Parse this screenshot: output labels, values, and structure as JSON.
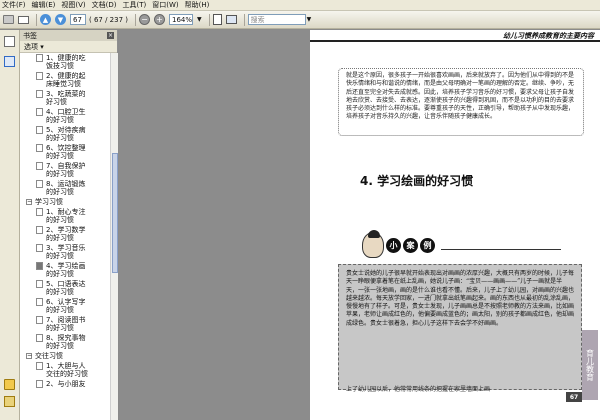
{
  "menu": [
    "文件(F)",
    "编辑(E)",
    "视图(V)",
    "文档(D)",
    "工具(T)",
    "窗口(W)",
    "帮助(H)"
  ],
  "toolbar": {
    "page_input": "67",
    "page_count": "( 67 / 237 )",
    "zoom": "164%",
    "search_placeholder": "搜索"
  },
  "panel": {
    "title": "书签",
    "close": "×",
    "options": "选项 ▾"
  },
  "bookmarks": [
    {
      "kind": "item",
      "label": "1、健康的吃\n饭技习惯"
    },
    {
      "kind": "item",
      "label": "2、健康的起\n床睡觉习惯"
    },
    {
      "kind": "item",
      "label": "3、吃蔬菜的\n好习惯"
    },
    {
      "kind": "item",
      "label": "4、口腔卫生\n的好习惯"
    },
    {
      "kind": "item",
      "label": "5、对待疾病\n的好习惯"
    },
    {
      "kind": "item",
      "label": "6、饮控整理\n的好习惯"
    },
    {
      "kind": "item",
      "label": "7、自我保护\n的好习惯"
    },
    {
      "kind": "item",
      "label": "8、运动锻炼\n的好习惯"
    },
    {
      "kind": "group",
      "label": "学习习惯"
    },
    {
      "kind": "item",
      "label": "1、耐心专注\n的好习惯"
    },
    {
      "kind": "item",
      "label": "2、学习数学\n的好习惯"
    },
    {
      "kind": "item",
      "label": "3、学习音乐\n的好习惯"
    },
    {
      "kind": "item",
      "label": "4、学习绘画\n的好习惯",
      "selected": true
    },
    {
      "kind": "item",
      "label": "5、口语表达\n的好习惯"
    },
    {
      "kind": "item",
      "label": "6、认字写字\n的好习惯"
    },
    {
      "kind": "item",
      "label": "7、阅读图书\n的好习惯"
    },
    {
      "kind": "item",
      "label": "8、探究事物\n的好习惯"
    },
    {
      "kind": "group",
      "label": "交往习惯"
    },
    {
      "kind": "item",
      "label": "1、大胆与人\n交往的好习惯"
    },
    {
      "kind": "item",
      "label": "2、与小朋友"
    }
  ],
  "page": {
    "header": "幼儿习惯养成教育的主要内容",
    "para1": "就是这个原因，很多孩子一开始很喜欢画画，后来就放弃了。因为他们从中得到的不是快乐情绪和与和谐说的情绪，而是由父母明确对一笔画的理解的否定。继续、争吵，无后还直至完全对失去成就感。因此，培养孩子学习音乐的好习惯，要求父母让孩子自发地去欣赏、去接受、去表达，逐渐使孩子的兴趣得到巩固，而不是以功利的目的去要求孩子必须达到什么样的标准。要尊重孩子的天性，正确引导，帮助孩子从中发现乐趣，培养孩子对音乐持久的兴趣，让音乐伴随孩子健康成长。",
    "chapter": "4. 学习绘画的好习惯",
    "case_chars": [
      "小",
      "案",
      "例"
    ],
    "para2": "贵女士说她的儿子很早就开始表现出对画画的浓厚兴趣，大概只有两岁的时候，儿子每天一睁眼便拿着笔在纸上乱画，她说儿子画：“宝贝——画画——”儿子一画就是半天，一张一张地画，画的是什么谁也看不懂。后来，儿子上了幼儿园，对画画的兴趣也越来越浓。每天放学回家，一进门就拿出纸笔画起来。画的东西也从最初的乱涂乱画，慢慢地有了样子。可是，贵女士发现，儿子画画总是不按照老师教的方法来画，比如画苹果，老师让画成红色的，他偏要画成蓝色的；画太阳，别的孩子都画成红色，他却画成绿色。贵女士很着急，担心儿子这样下去会学不好画画。",
    "para3": "上了幼儿园以后，他常常用线条的把握在家里墙面上画",
    "page_number": "67",
    "watermark": "育儿教育"
  }
}
